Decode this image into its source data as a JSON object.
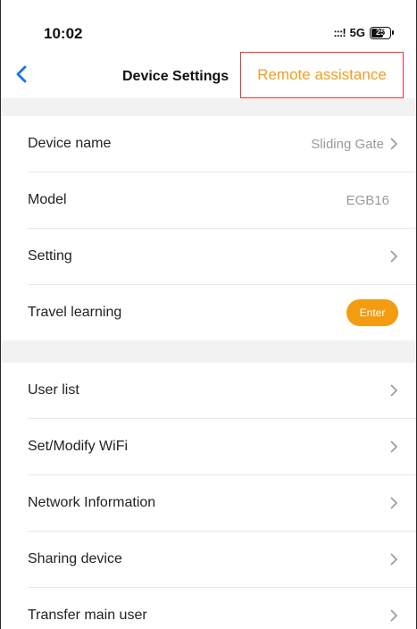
{
  "status_bar": {
    "time": "10:02",
    "signal": ":::!",
    "network": "5G",
    "battery": "25"
  },
  "nav": {
    "title": "Device Settings",
    "remote_assistance": "Remote assistance"
  },
  "colors": {
    "accent_orange": "#f39c12",
    "remote_text": "#f0a020",
    "highlight_border": "#e53935",
    "back_arrow": "#1a73e8"
  },
  "section1": {
    "device_name": {
      "label": "Device name",
      "value": "Sliding Gate"
    },
    "model": {
      "label": "Model",
      "value": "EGB16"
    },
    "setting": {
      "label": "Setting"
    },
    "travel_learning": {
      "label": "Travel learning",
      "button": "Enter"
    }
  },
  "section2": {
    "items": [
      {
        "label": "User list"
      },
      {
        "label": "Set/Modify WiFi"
      },
      {
        "label": "Network Information"
      },
      {
        "label": "Sharing device"
      },
      {
        "label": "Transfer main user"
      }
    ]
  }
}
